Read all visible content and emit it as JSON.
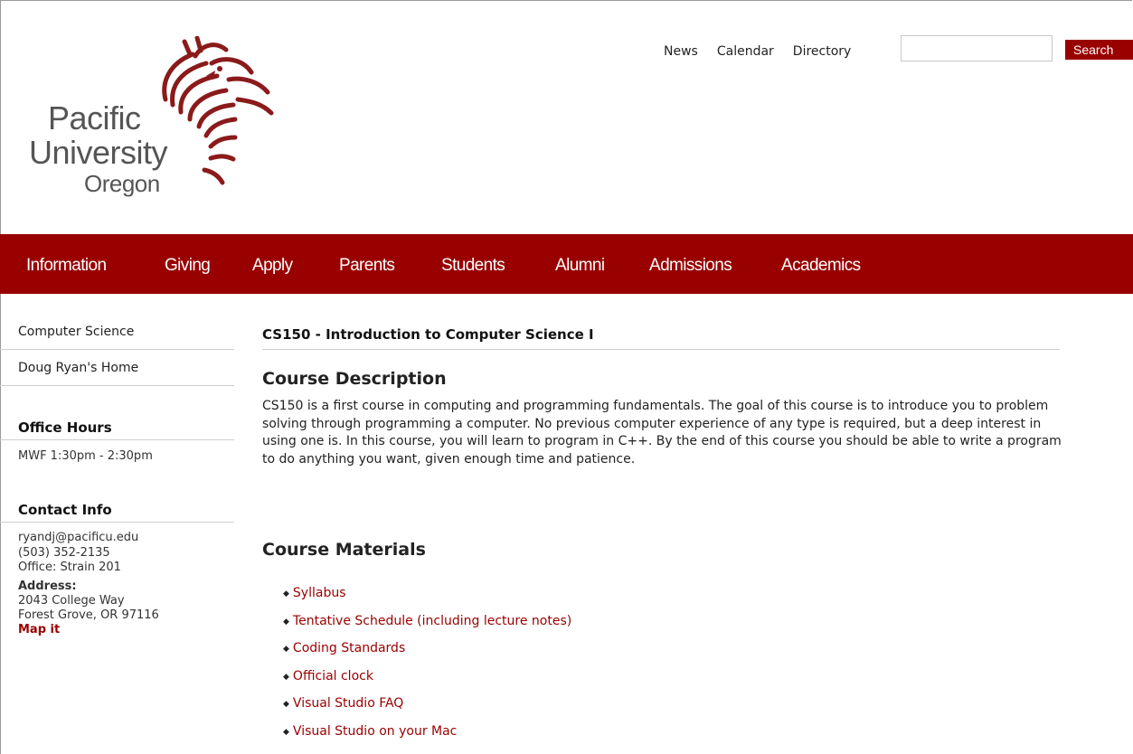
{
  "logo": {
    "line1": "Pacific",
    "line2": "University",
    "line3": "Oregon",
    "icon": "boxer-dragon-logo-icon"
  },
  "header": {
    "links": [
      "News",
      "Calendar",
      "Directory"
    ],
    "search_placeholder": "",
    "search_label": "Search"
  },
  "nav": {
    "items": [
      "Information",
      "Giving",
      "Apply",
      "Parents",
      "Students",
      "Alumni",
      "Admissions",
      "Academics"
    ]
  },
  "sidebar": {
    "links": [
      "Computer Science",
      "Doug Ryan's Home"
    ],
    "office_hours": {
      "heading": "Office Hours",
      "text": "MWF 1:30pm - 2:30pm"
    },
    "contact": {
      "heading": "Contact Info",
      "email": "ryandj@pacificu.edu",
      "phone": "(503) 352-2135",
      "office": "Office: Strain 201",
      "address_label": "Address:",
      "address_line1": "2043 College Way",
      "address_line2": "Forest Grove, OR 97116",
      "map_link": "Map it"
    }
  },
  "main": {
    "title": "CS150 - Introduction to Computer Science I",
    "description_heading": "Course Description",
    "description": "CS150 is a first course in computing and programming fundamentals. The goal of this course is to introduce you to problem solving through programming a computer. No previous computer experience of any type is required, but a deep interest in using one is. In this course, you will learn to program in C++. By the end of this course you should be able to write a program to do anything you want, given enough time and patience.",
    "materials_heading": "Course Materials",
    "materials": [
      "Syllabus",
      "Tentative Schedule (including lecture notes)",
      "Coding Standards",
      "Official clock",
      "Visual Studio FAQ",
      "Visual Studio on your Mac"
    ]
  },
  "colors": {
    "brand": "#990000",
    "link": "#990000"
  }
}
